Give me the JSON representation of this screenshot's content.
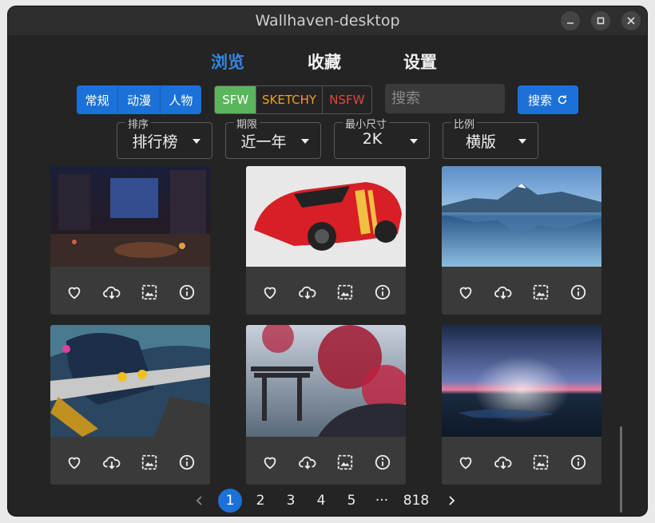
{
  "window": {
    "title": "Wallhaven-desktop"
  },
  "nav": {
    "browse": "浏览",
    "favorites": "收藏",
    "settings": "设置"
  },
  "categories": [
    "常规",
    "动漫",
    "人物"
  ],
  "purity": {
    "items": [
      "SFW",
      "SKETCHY",
      "NSFW"
    ],
    "colors": {
      "sfw_bg": "#5ab65c",
      "sketchy_fg": "#f0a020",
      "nsfw_fg": "#e0483e"
    }
  },
  "search": {
    "placeholder": "搜索",
    "button": "搜索"
  },
  "filters": {
    "sort": {
      "label": "排序",
      "value": "排行榜"
    },
    "range": {
      "label": "期限",
      "value": "近一年"
    },
    "min_size": {
      "label": "最小尺寸",
      "value": "2K"
    },
    "ratio": {
      "label": "比例",
      "value": "横版"
    }
  },
  "wallpapers": [
    {
      "subject": "messy-room-illustration"
    },
    {
      "subject": "red-sports-car"
    },
    {
      "subject": "mountain-lake-reflection"
    },
    {
      "subject": "anime-warrior-art"
    },
    {
      "subject": "torii-gate-cherry-blossom"
    },
    {
      "subject": "sea-horizon-dusk"
    }
  ],
  "card_actions": [
    "heart-icon",
    "cloud-download-icon",
    "set-wallpaper-icon",
    "info-icon"
  ],
  "pagination": {
    "pages": [
      "1",
      "2",
      "3",
      "4",
      "5"
    ],
    "ellipsis": "···",
    "last": "818",
    "current": "1"
  },
  "colors": {
    "accent": "#1c71d8",
    "window_bg": "#242424",
    "card_bg": "#3a3a3a"
  }
}
